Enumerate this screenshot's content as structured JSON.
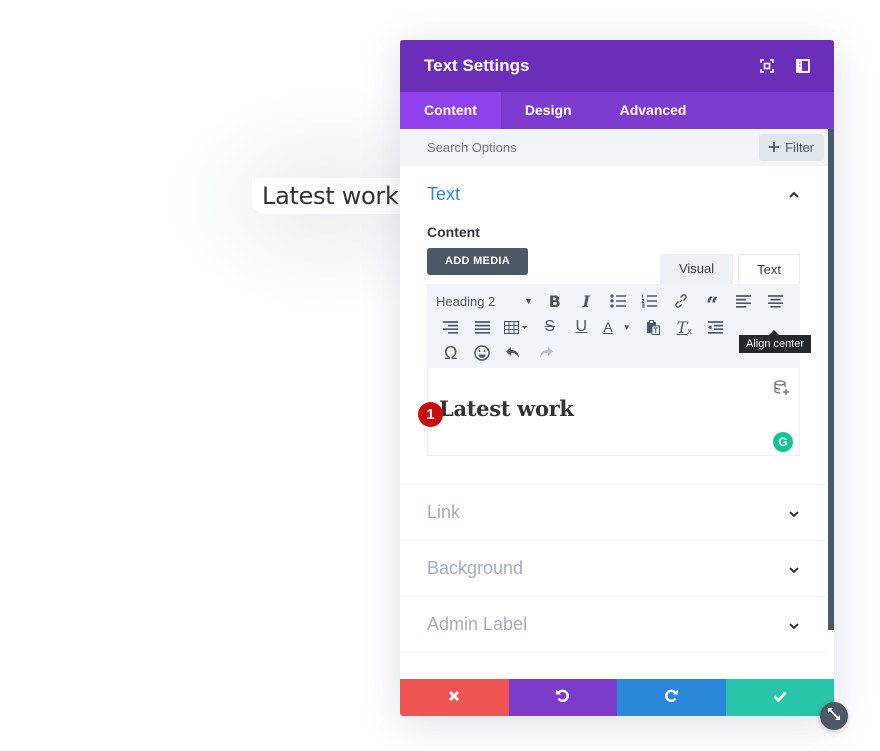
{
  "page": {
    "heading": "Latest work"
  },
  "modal": {
    "title": "Text Settings",
    "header_icons": [
      "fullscreen-icon",
      "split-view-icon"
    ],
    "tabs": [
      {
        "label": "Content",
        "active": true
      },
      {
        "label": "Design",
        "active": false
      },
      {
        "label": "Advanced",
        "active": false
      }
    ],
    "search": {
      "placeholder": "Search Options",
      "value": ""
    },
    "filter_label": "Filter",
    "sections": {
      "text": {
        "title": "Text",
        "expanded": true,
        "field_label": "Content",
        "add_media_label": "ADD MEDIA",
        "mode_tabs": [
          "Visual",
          "Text"
        ],
        "format_select": "Heading 2",
        "tooltip": "Align center",
        "editor_content": "Latest work",
        "marker": "1",
        "grammarly_glyph": "G"
      },
      "link": {
        "title": "Link",
        "expanded": false
      },
      "background": {
        "title": "Background",
        "expanded": false
      },
      "admin_label": {
        "title": "Admin Label",
        "expanded": false
      }
    },
    "footer": {
      "cancel": "cancel-icon",
      "undo": "undo-icon",
      "redo": "redo-icon",
      "save": "save-icon"
    },
    "colors": {
      "header": "#6c2eb9",
      "tabs": "#7e3bd0",
      "active_tab": "#8f42ec",
      "section_title_active": "#2b87da",
      "cancel": "#ef5555",
      "undo": "#7c3bc8",
      "redo": "#2b87da",
      "save": "#29c4a9"
    }
  }
}
